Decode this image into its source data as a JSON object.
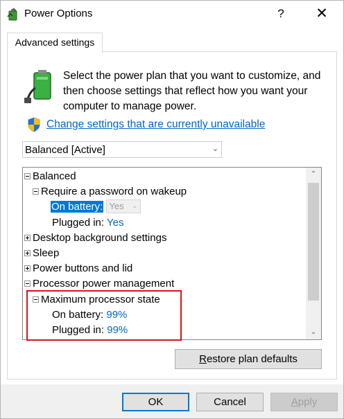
{
  "window": {
    "title": "Power Options",
    "help_label": "?",
    "close_label": "✕"
  },
  "tabs": [
    {
      "label": "Advanced settings"
    }
  ],
  "intro": {
    "text": "Select the power plan that you want to customize, and then choose settings that reflect how you want your computer to manage power.",
    "change_link": "Change settings that are currently unavailable"
  },
  "plan_select": {
    "value": "Balanced [Active]"
  },
  "tree": {
    "balanced": "Balanced",
    "require_password": "Require a password on wakeup",
    "rp_on_battery_label": "On battery:",
    "rp_on_battery_value": "Yes",
    "rp_plugged_in_label": "Plugged in:",
    "rp_plugged_in_value": "Yes",
    "desktop_background": "Desktop background settings",
    "sleep": "Sleep",
    "power_buttons": "Power buttons and lid",
    "processor_power": "Processor power management",
    "max_processor_state": "Maximum processor state",
    "mps_on_battery_label": "On battery:",
    "mps_on_battery_value": "99%",
    "mps_plugged_in_label": "Plugged in:",
    "mps_plugged_in_value": "99%"
  },
  "buttons": {
    "restore_prefix": "R",
    "restore_rest": "estore plan defaults",
    "ok": "OK",
    "cancel": "Cancel",
    "apply_prefix": "A",
    "apply_rest": "pply"
  },
  "colors": {
    "link": "#0066cc",
    "selection": "#0078d7",
    "highlight_box": "#d9131a"
  },
  "icons": [
    "power-options-icon",
    "help-icon",
    "close-icon",
    "battery-plug-icon",
    "uac-shield-icon",
    "chevron-down-icon",
    "scroll-up-icon",
    "scroll-down-icon"
  ]
}
